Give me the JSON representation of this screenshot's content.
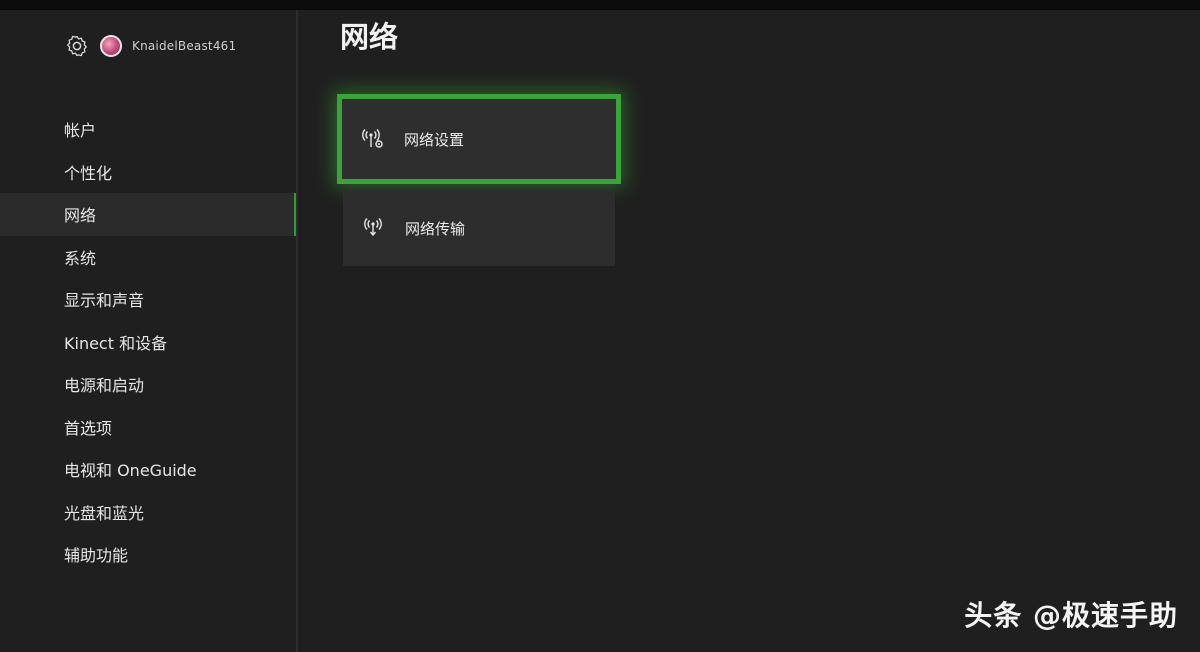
{
  "profile": {
    "username": "KnaidelBeast461",
    "settings_icon": "gear-icon",
    "avatar_icon": "avatar"
  },
  "sidebar": {
    "items": [
      {
        "label": "帐户"
      },
      {
        "label": "个性化"
      },
      {
        "label": "网络",
        "selected": true
      },
      {
        "label": "系统"
      },
      {
        "label": "显示和声音"
      },
      {
        "label": "Kinect 和设备"
      },
      {
        "label": "电源和启动"
      },
      {
        "label": "首选项"
      },
      {
        "label": "电视和 OneGuide"
      },
      {
        "label": "光盘和蓝光"
      },
      {
        "label": "辅助功能"
      }
    ]
  },
  "main": {
    "title": "网络",
    "tiles": [
      {
        "label": "网络设置",
        "icon": "network-settings-icon",
        "focused": true
      },
      {
        "label": "网络传输",
        "icon": "network-transfer-icon",
        "focused": false
      }
    ]
  },
  "watermark": "头条 @极速手助",
  "colors": {
    "focus_green": "#3aa33a",
    "background": "#1f1f1f",
    "tile": "#2d2d2d"
  }
}
